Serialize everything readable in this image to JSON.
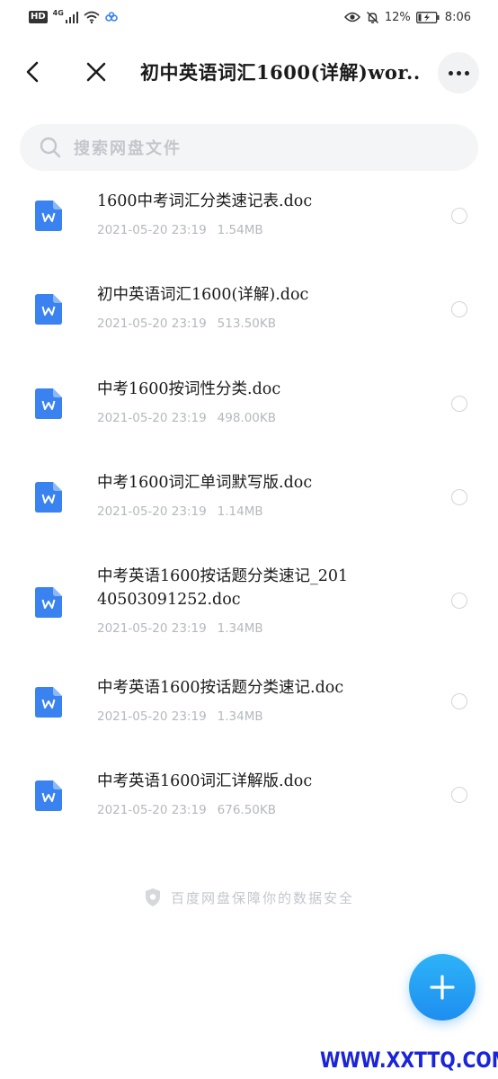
{
  "status_bar": {
    "hd": "HD",
    "network": "4G",
    "battery_pct": "12%",
    "time": "8:06"
  },
  "nav": {
    "title": "初中英语词汇1600(详解)wor...",
    "back_icon": "chevron-left-icon",
    "close_icon": "close-icon",
    "more_icon": "more-icon"
  },
  "search": {
    "placeholder": "搜索网盘文件"
  },
  "files": [
    {
      "name": "1600中考词汇分类速记表.doc",
      "date": "2021-05-20 23:19",
      "size": "1.54MB"
    },
    {
      "name": "初中英语词汇1600(详解).doc",
      "date": "2021-05-20 23:19",
      "size": "513.50KB"
    },
    {
      "name": "中考1600按词性分类.doc",
      "date": "2021-05-20 23:19",
      "size": "498.00KB"
    },
    {
      "name": "中考1600词汇单词默写版.doc",
      "date": "2021-05-20 23:19",
      "size": "1.14MB"
    },
    {
      "name": "中考英语1600按话题分类速记_20140503091252.doc",
      "date": "2021-05-20 23:19",
      "size": "1.34MB"
    },
    {
      "name": "中考英语1600按话题分类速记.doc",
      "date": "2021-05-20 23:19",
      "size": "1.34MB"
    },
    {
      "name": "中考英语1600词汇详解版.doc",
      "date": "2021-05-20 23:19",
      "size": "676.50KB"
    }
  ],
  "footer": {
    "safety_text": "百度网盘保障你的数据安全"
  },
  "watermark": "WWW.XXTTQ.COM",
  "colors": {
    "accent": "#1e8ef0",
    "doc_icon": "#3a82f0",
    "meta_text": "#b5b8be",
    "watermark": "#1a24d8"
  }
}
